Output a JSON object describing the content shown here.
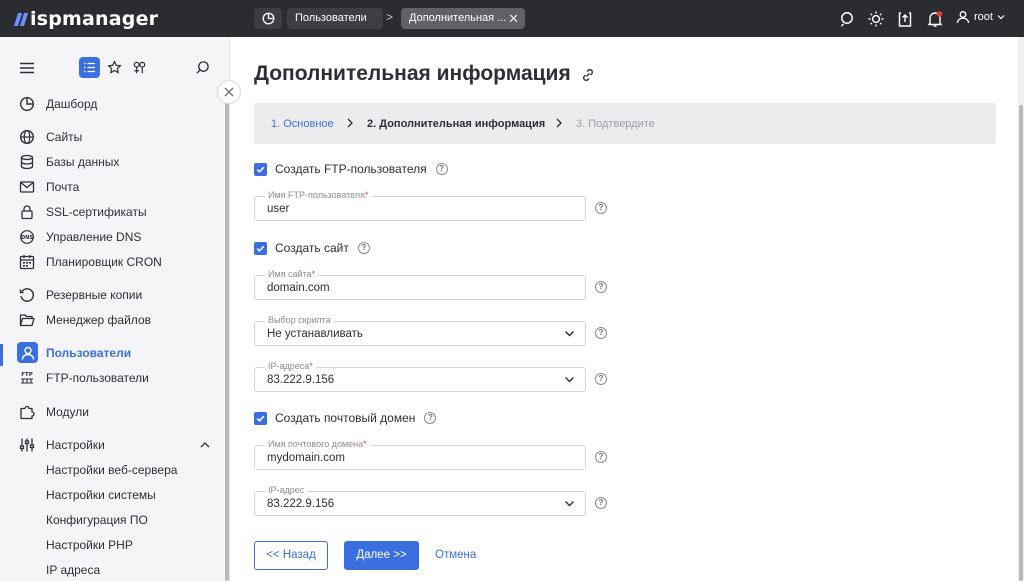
{
  "app": {
    "logo": "ispmanager"
  },
  "topbar": {
    "tabs": [
      {
        "label": "Пользователи"
      },
      {
        "label": "Дополнительная ..."
      }
    ],
    "breadcrumb_separator": ">",
    "close_glyph": "✕",
    "user": "root"
  },
  "sidebar": {
    "items": [
      {
        "label": "Дашборд",
        "icon": "dashboard-icon"
      },
      {
        "label": "Сайты",
        "icon": "globe-icon"
      },
      {
        "label": "Базы данных",
        "icon": "database-icon"
      },
      {
        "label": "Почта",
        "icon": "mail-icon"
      },
      {
        "label": "SSL-сертификаты",
        "icon": "lock-icon"
      },
      {
        "label": "Управление DNS",
        "icon": "dns-icon"
      },
      {
        "label": "Планировщик CRON",
        "icon": "calendar-icon"
      },
      {
        "label": "Резервные копии",
        "icon": "backup-icon"
      },
      {
        "label": "Менеджер файлов",
        "icon": "folder-icon"
      },
      {
        "label": "Пользователи",
        "icon": "user-icon",
        "active": true
      },
      {
        "label": "FTP-пользователи",
        "icon": "ftp-icon"
      },
      {
        "label": "Модули",
        "icon": "puzzle-icon"
      },
      {
        "label": "Настройки",
        "icon": "settings-icon",
        "expanded": true
      },
      {
        "label": "Настройки веб-сервера"
      },
      {
        "label": "Настройки системы"
      },
      {
        "label": "Конфигурация ПО"
      },
      {
        "label": "Настройки PHP"
      },
      {
        "label": "IP адреса"
      }
    ]
  },
  "page": {
    "title": "Дополнительная информация",
    "steps": [
      {
        "label": "1. Основное",
        "state": "done"
      },
      {
        "label": "2. Дополнительная информация",
        "state": "current"
      },
      {
        "label": "3. Подтвердите",
        "state": "pending"
      }
    ]
  },
  "form": {
    "ftp_checkbox": {
      "label": "Создать FTP-пользователя",
      "checked": true
    },
    "ftp_user": {
      "label": "Имя FTP-пользователя",
      "required_mark": "*",
      "value": "user"
    },
    "site_checkbox": {
      "label": "Создать сайт",
      "checked": true
    },
    "site_name": {
      "label": "Имя сайта",
      "required_mark": "*",
      "value": "domain.com"
    },
    "script": {
      "label": "Выбор скрипта",
      "value": "Не устанавливать"
    },
    "site_ip": {
      "label": "IP-адреса",
      "required_mark": "*",
      "value": "83.222.9.156"
    },
    "mail_checkbox": {
      "label": "Создать почтовый домен",
      "checked": true
    },
    "mail_domain": {
      "label": "Имя почтового домена",
      "required_mark": "*",
      "value": "mydomain.com"
    },
    "mail_ip": {
      "label": "IP-адрес",
      "value": "83.222.9.156"
    },
    "help_glyph": "?"
  },
  "buttons": {
    "back": "<< Назад",
    "next": "Далее >>",
    "cancel": "Отмена"
  },
  "colors": {
    "accent": "#3b6fe0",
    "topbar": "#2b2c31",
    "sidebar": "#f5f5f7",
    "required": "#e03d3d"
  }
}
